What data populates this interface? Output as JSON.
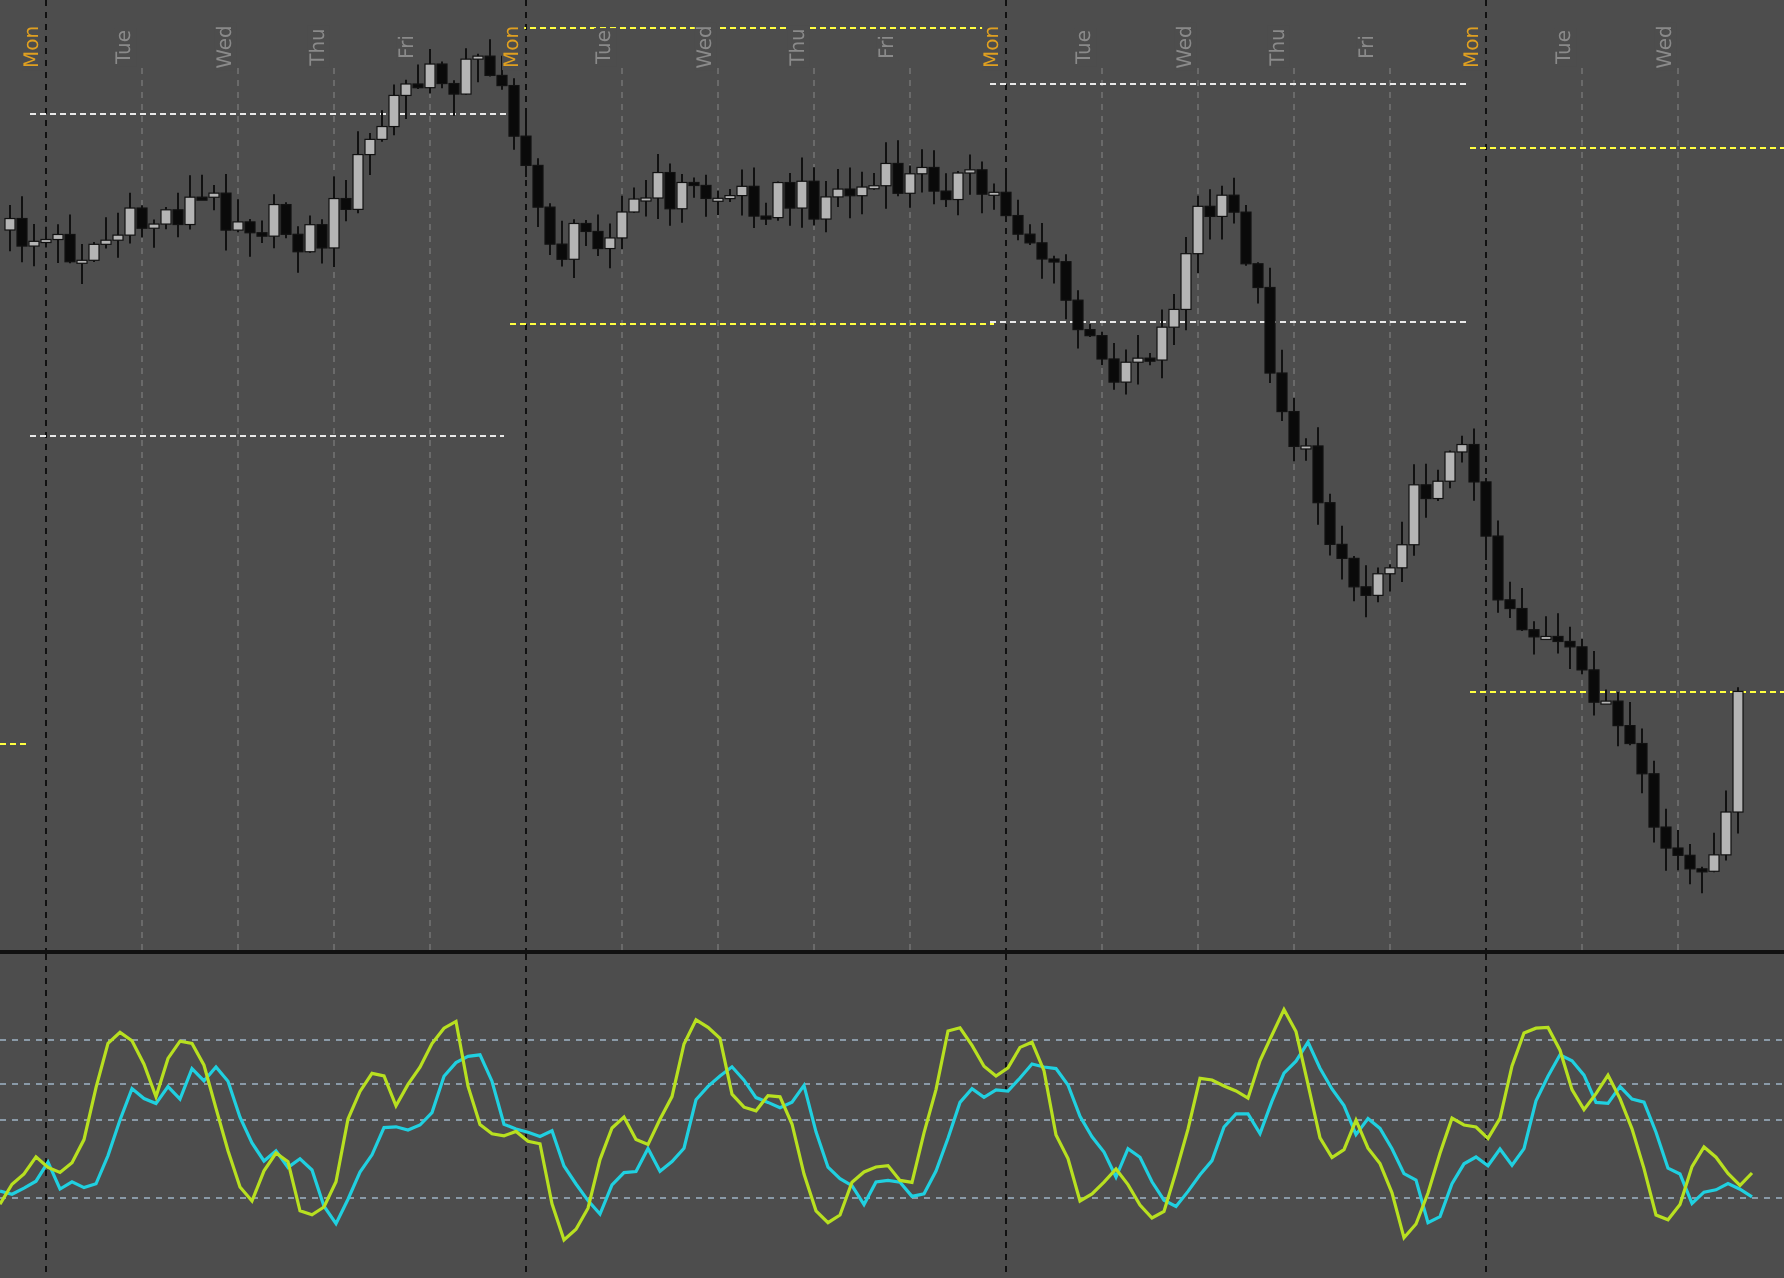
{
  "time_axis": {
    "labels": [
      {
        "text": "Mon",
        "kind": "week"
      },
      {
        "text": "Tue",
        "kind": "day"
      },
      {
        "text": "Wed",
        "kind": "day"
      },
      {
        "text": "Thu",
        "kind": "day"
      },
      {
        "text": "Fri",
        "kind": "day"
      },
      {
        "text": "Mon",
        "kind": "week"
      },
      {
        "text": "Tue",
        "kind": "day"
      },
      {
        "text": "Wed",
        "kind": "day"
      },
      {
        "text": "Thu",
        "kind": "day"
      },
      {
        "text": "Fri",
        "kind": "day"
      },
      {
        "text": "Mon",
        "kind": "week"
      },
      {
        "text": "Tue",
        "kind": "day"
      },
      {
        "text": "Wed",
        "kind": "day"
      },
      {
        "text": "Thu",
        "kind": "day"
      },
      {
        "text": "Fri",
        "kind": "day"
      },
      {
        "text": "Mon",
        "kind": "week"
      },
      {
        "text": "Tue",
        "kind": "day"
      },
      {
        "text": "Wed",
        "kind": "day"
      }
    ]
  }
}
